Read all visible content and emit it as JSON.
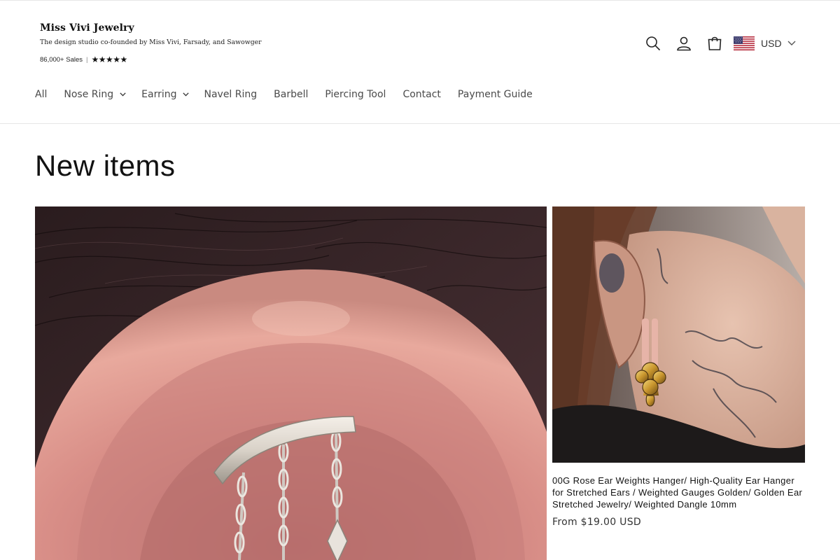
{
  "brand": {
    "name": "Miss Vivi Jewelry",
    "tagline": "The design studio co-founded by Miss Vivi, Farsady, and Sawowger",
    "sales": "86,000+ Sales",
    "separator": "|",
    "stars": "★★★★★",
    "rating_stars": 5
  },
  "header": {
    "icons": [
      "search-icon",
      "account-icon",
      "cart-icon"
    ],
    "currency": {
      "flag": "us-flag-icon",
      "label": "USD"
    }
  },
  "nav": {
    "items": [
      {
        "label": "All",
        "has_dropdown": false
      },
      {
        "label": "Nose Ring",
        "has_dropdown": true
      },
      {
        "label": "Earring",
        "has_dropdown": true
      },
      {
        "label": "Navel Ring",
        "has_dropdown": false
      },
      {
        "label": "Barbell",
        "has_dropdown": false
      },
      {
        "label": "Piercing Tool",
        "has_dropdown": false
      },
      {
        "label": "Contact",
        "has_dropdown": false
      },
      {
        "label": "Payment Guide",
        "has_dropdown": false
      }
    ]
  },
  "section": {
    "title": "New items"
  },
  "products": [
    {
      "image": "curved-barbell-chain-dangle-photo"
    },
    {
      "image": "rose-ear-weights-photo",
      "title": "00G Rose Ear Weights Hanger/ High-Quality Ear Hanger for Stretched Ears / Weighted Gauges Golden/ Golden Ear Stretched Jewelry/ Weighted Dangle 10mm",
      "price": "From $19.00 USD"
    }
  ],
  "colors": {
    "text": "#121212",
    "nav_text": "#4a4a4a",
    "divider": "#e6e6e6"
  }
}
